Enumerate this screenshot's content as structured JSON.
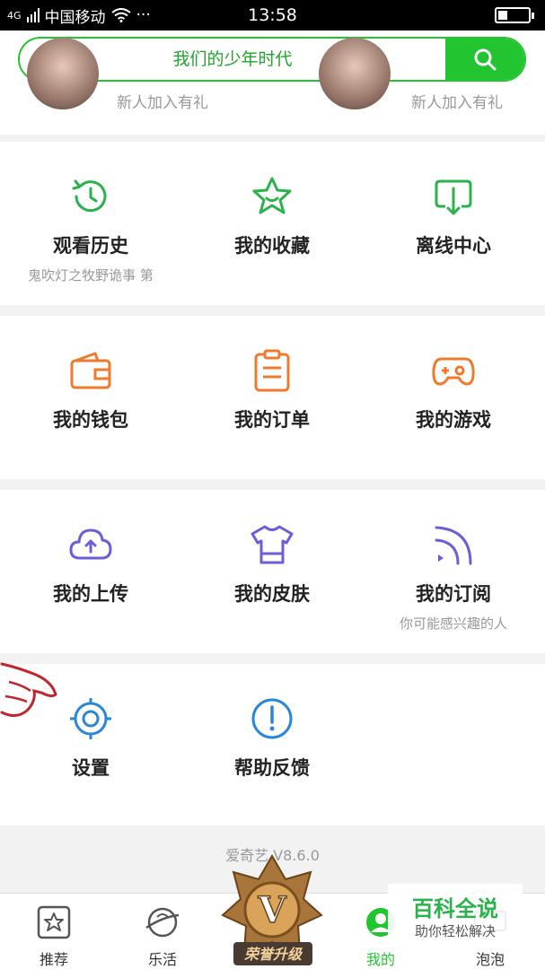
{
  "status_bar": {
    "carrier": "中国移动",
    "time": "13:58",
    "more": "···",
    "signal_label": "4G"
  },
  "search": {
    "text": "我们的少年时代",
    "icon": "search-icon"
  },
  "top_strip": {
    "left_label": "新人加入有礼",
    "right_label": "新人加入有礼"
  },
  "sections": [
    {
      "items": [
        {
          "label": "观看历史",
          "sub": "鬼吹灯之牧野诡事 第",
          "icon": "history-clock-icon",
          "color": "#2bb24c"
        },
        {
          "label": "我的收藏",
          "sub": "",
          "icon": "star-icon",
          "color": "#2bb24c"
        },
        {
          "label": "离线中心",
          "sub": "",
          "icon": "download-icon",
          "color": "#2bb24c"
        }
      ]
    },
    {
      "items": [
        {
          "label": "我的钱包",
          "sub": "",
          "icon": "wallet-icon",
          "color": "#ef7a2c"
        },
        {
          "label": "我的订单",
          "sub": "",
          "icon": "clipboard-icon",
          "color": "#ef7a2c"
        },
        {
          "label": "我的游戏",
          "sub": "",
          "icon": "gamepad-icon",
          "color": "#ef7a2c"
        }
      ]
    },
    {
      "items": [
        {
          "label": "我的上传",
          "sub": "",
          "icon": "cloud-upload-icon",
          "color": "#6a5fd8"
        },
        {
          "label": "我的皮肤",
          "sub": "",
          "icon": "tshirt-icon",
          "color": "#6a5fd8"
        },
        {
          "label": "我的订阅",
          "sub": "你可能感兴趣的人",
          "icon": "rss-icon",
          "color": "#6a5fd8"
        }
      ]
    },
    {
      "items": [
        {
          "label": "设置",
          "sub": "",
          "icon": "settings-gear-icon",
          "color": "#2a86d8"
        },
        {
          "label": "帮助反馈",
          "sub": "",
          "icon": "help-exclamation-icon",
          "color": "#2a86d8"
        }
      ]
    }
  ],
  "version": "爱奇艺 V8.6.0",
  "bottom_nav": [
    {
      "label": "推荐",
      "icon": "star-box-icon"
    },
    {
      "label": "乐活",
      "icon": "planet-icon"
    },
    {
      "label": "我的",
      "icon": "user-icon",
      "active": true
    },
    {
      "label": "泡泡",
      "icon": "bubble-icon"
    }
  ],
  "upgrade_badge": {
    "text": "荣誉升级",
    "letter": "V"
  },
  "watermark": {
    "title": "百科全说",
    "subtitle": "助你轻松解决"
  },
  "colors": {
    "brand_green": "#22c530",
    "orange": "#ef7a2c",
    "purple": "#6a5fd8",
    "blue": "#2a86d8"
  }
}
